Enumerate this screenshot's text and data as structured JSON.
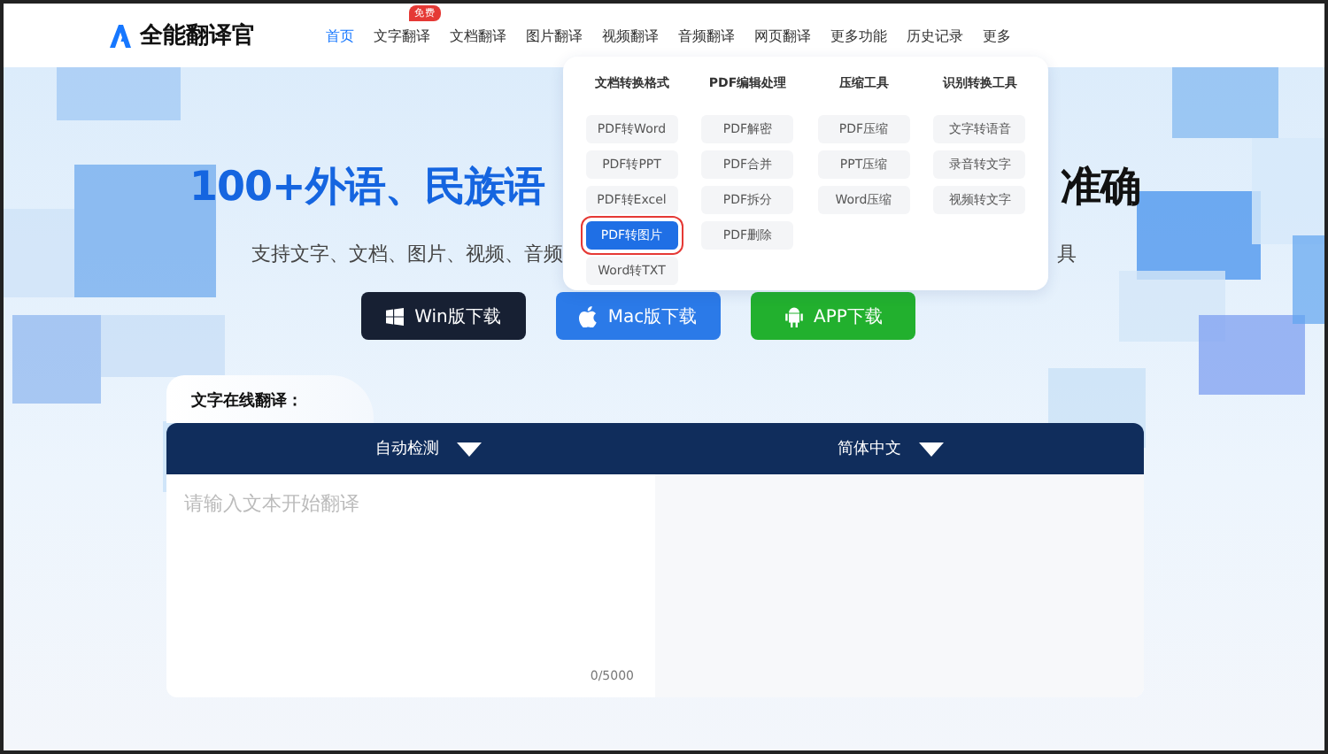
{
  "header": {
    "logo": "全能翻译官",
    "nav": [
      {
        "label": "首页",
        "selected": true
      },
      {
        "label": "文字翻译",
        "selected": false,
        "badge": "免费"
      },
      {
        "label": "文档翻译",
        "selected": false
      },
      {
        "label": "图片翻译",
        "selected": false
      },
      {
        "label": "视频翻译",
        "selected": false
      },
      {
        "label": "音频翻译",
        "selected": false
      },
      {
        "label": "网页翻译",
        "selected": false
      },
      {
        "label": "更多功能",
        "selected": false
      },
      {
        "label": "历史记录",
        "selected": false
      },
      {
        "label": "更多",
        "selected": false
      }
    ]
  },
  "menu": {
    "columns": [
      {
        "title": "文档转换格式",
        "items": [
          {
            "label": "PDF转Word",
            "selected": false
          },
          {
            "label": "PDF转PPT",
            "selected": false
          },
          {
            "label": "PDF转Excel",
            "selected": false
          },
          {
            "label": "PDF转图片",
            "selected": true
          },
          {
            "label": "Word转TXT",
            "selected": false
          }
        ]
      },
      {
        "title": "PDF编辑处理",
        "items": [
          {
            "label": "PDF解密",
            "selected": false
          },
          {
            "label": "PDF合并",
            "selected": false
          },
          {
            "label": "PDF拆分",
            "selected": false
          },
          {
            "label": "PDF删除",
            "selected": false
          }
        ]
      },
      {
        "title": "压缩工具",
        "items": [
          {
            "label": "PDF压缩",
            "selected": false
          },
          {
            "label": "PPT压缩",
            "selected": false
          },
          {
            "label": "Word压缩",
            "selected": false
          }
        ]
      },
      {
        "title": "识别转换工具",
        "items": [
          {
            "label": "文字转语音",
            "selected": false
          },
          {
            "label": "录音转文字",
            "selected": false
          },
          {
            "label": "视频转文字",
            "selected": false
          }
        ]
      }
    ]
  },
  "hero": {
    "headline": [
      "100+外语、民族语",
      "准确"
    ],
    "subtitle": [
      "支持文字、文档、图片、视频、音频",
      "具"
    ],
    "downloads": [
      {
        "label": "Win版下载",
        "kind": "windows"
      },
      {
        "label": "Mac版下载",
        "kind": "mac"
      },
      {
        "label": "APP下载",
        "kind": "android"
      }
    ]
  },
  "translator": {
    "tab": "文字在线翻译：",
    "source_language": "自动检测",
    "target_language": "简体中文",
    "input": {
      "placeholder": "请输入文本开始翻译"
    },
    "counter": "0/5000"
  }
}
